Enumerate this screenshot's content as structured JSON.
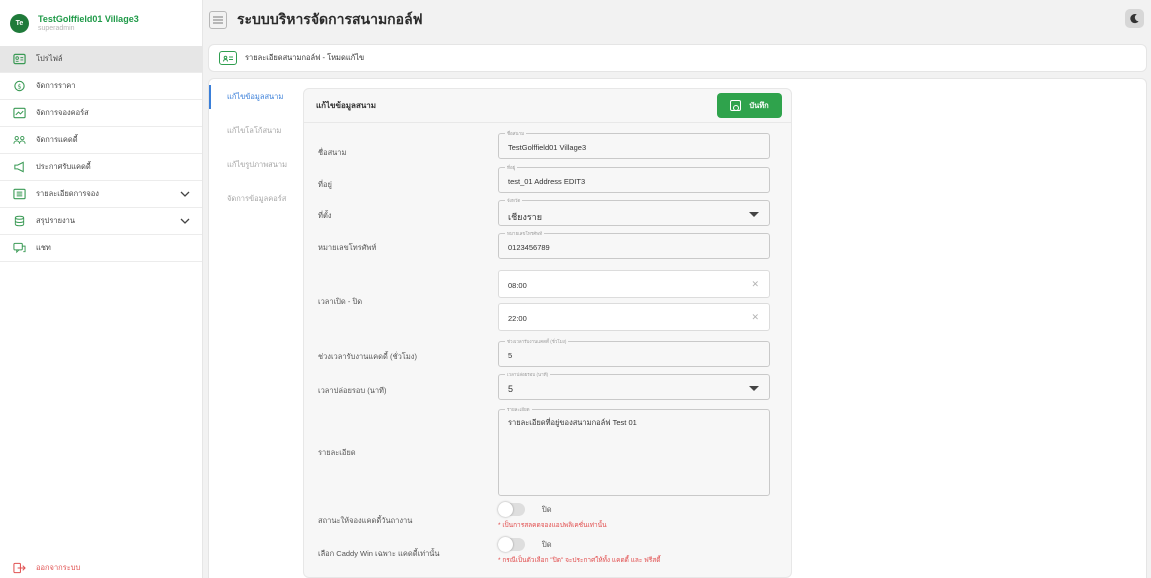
{
  "app": {
    "title": "ระบบบริหารจัดการสนามกอล์ฟ"
  },
  "user": {
    "initials": "Te",
    "name": "TestGolffield01 Village3",
    "role": "superadmin"
  },
  "sidebar": {
    "items": [
      {
        "label": "โปรไฟล์",
        "icon": "id-card-icon"
      },
      {
        "label": "จัดการราคา",
        "icon": "dollar-circle-icon"
      },
      {
        "label": "จัดการจองคอร์ส",
        "icon": "chart-icon"
      },
      {
        "label": "จัดการแคดดี้",
        "icon": "users-icon"
      },
      {
        "label": "ประกาศรับแคดดี้",
        "icon": "megaphone-icon"
      },
      {
        "label": "รายละเอียดการจอง",
        "icon": "list-icon"
      },
      {
        "label": "สรุปรายงาน",
        "icon": "database-icon"
      },
      {
        "label": "แชท",
        "icon": "chat-icon"
      }
    ],
    "logout": "ออกจากระบบ"
  },
  "breadcrumb": "รายละเอียดสนามกอล์ฟ - โหมดแก้ไข",
  "tabs": [
    "แก้ไขข้อมูลสนาม",
    "แก้ไขโลโก้สนาม",
    "แก้ไขรูปภาพสนาม",
    "จัดการข้อมูลคอร์ส"
  ],
  "form": {
    "title": "แก้ไขข้อมูลสนาม",
    "save": "บันทึก",
    "name": {
      "label": "ชื่อสนาม",
      "legend": "ชื่อสนาม",
      "value": "TestGolffield01 Village3"
    },
    "address": {
      "label": "ที่อยู่",
      "legend": "ที่อยู่",
      "value": "test_01 Address EDIT3"
    },
    "province": {
      "label": "ที่ตั้ง",
      "legend": "จังหวัด",
      "value": "เชียงราย"
    },
    "phone": {
      "label": "หมายเลขโทรศัพท์",
      "legend": "หมายเลขโทรศัพท์",
      "value": "0123456789"
    },
    "hours": {
      "label": "เวลาเปิด - ปิด",
      "open": "08:00",
      "close": "22:00"
    },
    "caddy_hours": {
      "label": "ช่วงเวลารับงานแคดดี้ (ชั่วโมง)",
      "legend": "ช่วงเวลารับงานแคดดี้ (ชั่วโมง)",
      "value": "5"
    },
    "release": {
      "label": "เวลาปล่อยรอบ (นาที)",
      "legend": "เวลาปล่อยรอบ (นาที)",
      "value": "5"
    },
    "details": {
      "label": "รายละเอียด",
      "legend": "รายละเอียด",
      "value": "รายละเอียดที่อยู่ของสนามกอล์ฟ Test 01"
    },
    "toggle1": {
      "label": "สถานะให้จองแคดดี้วันถางาน",
      "state": "ปิด",
      "note": "* เป็นการสลคดจองแอปพลิเคชั่นเท่านั้น"
    },
    "toggle2": {
      "label": "เลือก Caddy Win เฉพาะ แคดดี้เท่านั้น",
      "state": "ปิด",
      "note": "* กรณีเป็นตัวเลือก \"ปิด\" จะประกาศให้ทั้ง แคดดี้ และ ฟรีสดี้"
    }
  }
}
